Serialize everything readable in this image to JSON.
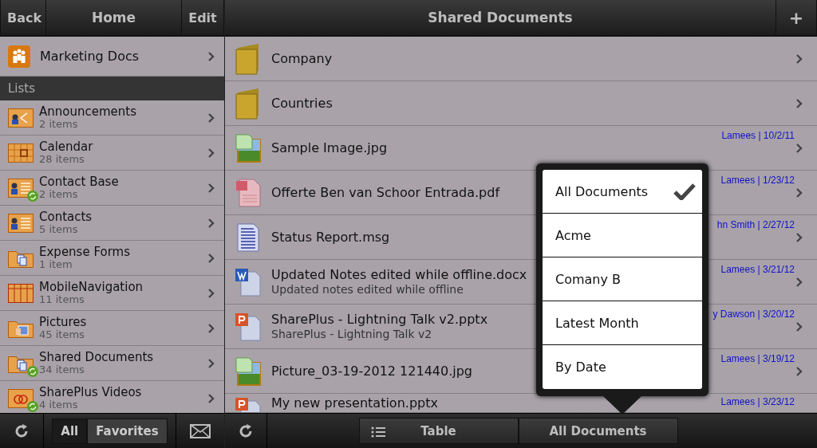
{
  "left_header": {
    "back": "Back",
    "title": "Home",
    "edit": "Edit"
  },
  "site": {
    "title": "Marketing Docs"
  },
  "section_header": "Lists",
  "lists": [
    {
      "name": "Announcements",
      "count": "2 items",
      "kind": "announcements",
      "synced": false
    },
    {
      "name": "Calendar",
      "count": "28 items",
      "kind": "calendar",
      "synced": false
    },
    {
      "name": "Contact Base",
      "count": "2 items",
      "kind": "contacts",
      "synced": true
    },
    {
      "name": "Contacts",
      "count": "5 items",
      "kind": "contacts",
      "synced": false
    },
    {
      "name": "Expense Forms",
      "count": "1 item",
      "kind": "library",
      "synced": false
    },
    {
      "name": "MobileNavigation",
      "count": "11 items",
      "kind": "table",
      "synced": false
    },
    {
      "name": "Pictures",
      "count": "45 items",
      "kind": "pictures",
      "synced": false
    },
    {
      "name": "Shared Documents",
      "count": "34 items",
      "kind": "library",
      "synced": true
    },
    {
      "name": "SharePlus Videos",
      "count": "4 items",
      "kind": "videos",
      "synced": true
    }
  ],
  "left_toolbar": {
    "filters": [
      {
        "label": "All",
        "selected": true
      },
      {
        "label": "Favorites",
        "selected": false
      }
    ]
  },
  "right_header": {
    "title": "Shared Documents",
    "add": "+"
  },
  "documents": [
    {
      "kind": "folder",
      "name": "Company"
    },
    {
      "kind": "folder",
      "name": "Countries"
    },
    {
      "kind": "jpg",
      "name": "Sample Image.jpg",
      "meta": "Lamees | 10/2/11"
    },
    {
      "kind": "pdf",
      "name": "Offerte Ben van Schoor Entrada.pdf",
      "meta": "Lamees | 1/23/12"
    },
    {
      "kind": "msg",
      "name": "Status Report.msg",
      "meta": "hn Smith | 2/27/12"
    },
    {
      "kind": "docx",
      "name": "Updated Notes edited while offline.docx",
      "subtitle": "Updated notes edited while offline",
      "meta": "Lamees | 3/21/12"
    },
    {
      "kind": "pptx",
      "name": "SharePlus - Lightning Talk v2.pptx",
      "subtitle": "SharePlus - Lightning Talk v2",
      "meta": "y Dawson | 3/20/12"
    },
    {
      "kind": "jpg",
      "name": "Picture_03-19-2012 121440.jpg",
      "meta": "Lamees | 3/19/12"
    },
    {
      "kind": "pptx",
      "name": "My new presentation.pptx",
      "meta": "Lamees | 3/23/12"
    }
  ],
  "bottom_toolbar": {
    "view": "Table",
    "filter": "All Documents"
  },
  "filter_menu": [
    {
      "label": "All Documents",
      "selected": true
    },
    {
      "label": "Acme",
      "selected": false
    },
    {
      "label": "Comany B",
      "selected": false
    },
    {
      "label": "Latest Month",
      "selected": false
    },
    {
      "label": "By Date",
      "selected": false
    }
  ]
}
